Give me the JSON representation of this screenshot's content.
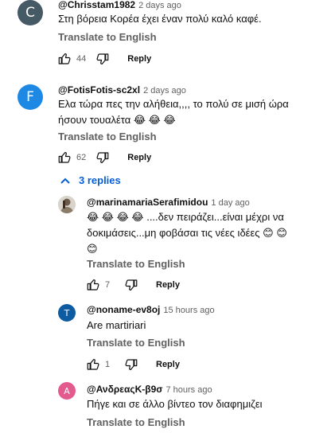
{
  "comments": [
    {
      "avatar_letter": "C",
      "avatar_color": "#455a64",
      "handle": "@Chrisstam1982",
      "time": "2 days ago",
      "text": "Στη βόρεια Κορέα έχει έναν πολύ καλό καφέ.",
      "translate": "Translate to English",
      "likes": "44",
      "reply_label": "Reply"
    },
    {
      "avatar_letter": "F",
      "avatar_color": "#1e88e5",
      "handle": "@FotisFotis-sc2xl",
      "time": "2 days ago",
      "text_line1": "Ελα τώρα πες την αλήθεια,,,, το πολύ σε μισή ώρα",
      "text_line2": "ήσουν τουαλέτα 😂 😂 😂",
      "translate": "Translate to English",
      "likes": "62",
      "reply_label": "Reply",
      "replies_toggle": "3 replies"
    }
  ],
  "replies": [
    {
      "avatar_type": "photo",
      "handle": "@marinamariaSerafimidou",
      "time": "1 day ago",
      "text_line1": "😂 😂 😂 😂 ....δεν πειράζει...είναι μέχρι να",
      "text_line2": "δοκιμάσεις...μη φοβάσαι τις νέες ιδέες 😊 😊",
      "text_line3": "😊",
      "translate": "Translate to English",
      "likes": "7",
      "reply_label": "Reply"
    },
    {
      "avatar_letter": "T",
      "avatar_color": "#0d5ba1",
      "handle": "@noname-ev8oj",
      "time": "15 hours ago",
      "text": "Are martiriari",
      "translate": "Translate to English",
      "likes": "1",
      "reply_label": "Reply"
    },
    {
      "avatar_letter": "A",
      "avatar_color": "#e25a8e",
      "handle": "@ΑνδρεαςΚ-β9σ",
      "time": "7 hours ago",
      "text": "Πήγε και σε άλλο βίντεο τον διαφημιζει",
      "translate": "Translate to English"
    }
  ]
}
